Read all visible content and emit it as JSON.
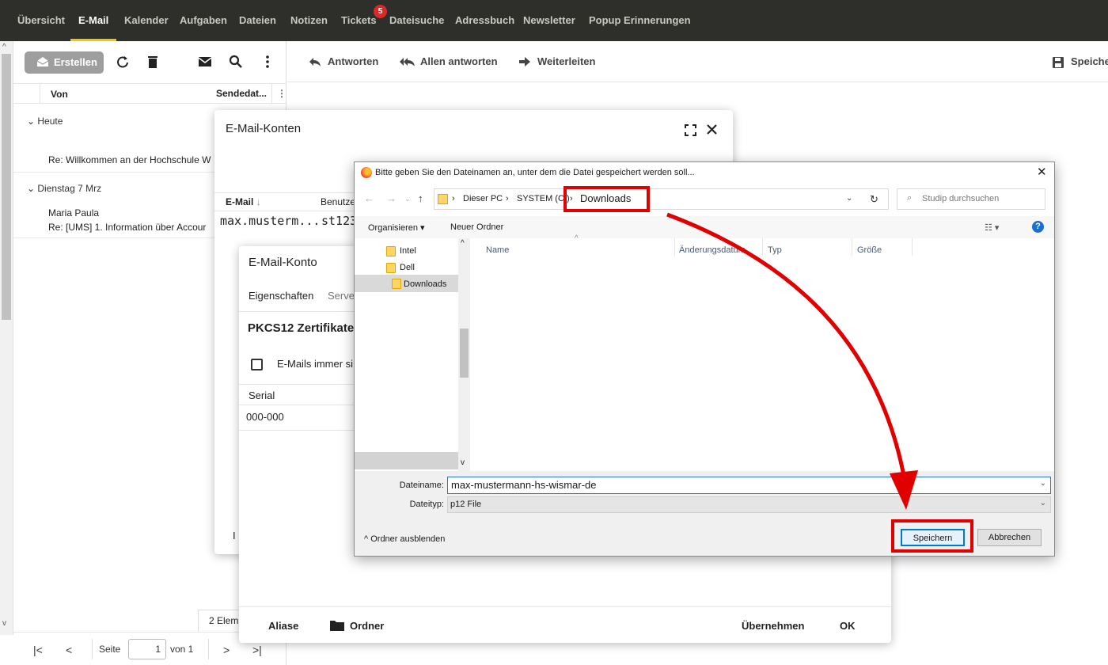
{
  "topnav": {
    "items": [
      "Übersicht",
      "E-Mail",
      "Kalender",
      "Aufgaben",
      "Dateien",
      "Notizen",
      "Tickets",
      "Dateisuche",
      "Adressbuch",
      "Newsletter",
      "Popup Erinnerungen"
    ],
    "active": "E-Mail",
    "tickets_badge": "5"
  },
  "listpanel": {
    "create_label": "Erstellen",
    "col_from": "Von",
    "col_date": "Sendedat...",
    "groups": [
      {
        "label": "Heute",
        "mails": [
          {
            "sender": "",
            "subject": "Re: Willkommen an der Hochschule W"
          }
        ]
      },
      {
        "label": "Dienstag 7 Mrz",
        "mails": [
          {
            "sender": "Maria Paula",
            "subject": "Re: [UMS] 1. Information über Accour"
          }
        ]
      }
    ],
    "count_label": "2 Elem",
    "pager": {
      "page_label": "Seite",
      "page_value": "1",
      "of_label": "von 1"
    }
  },
  "reader_toolbar": {
    "reply": "Antworten",
    "reply_all": "Allen antworten",
    "forward": "Weiterleiten",
    "save": "Speicher"
  },
  "accounts_dialog": {
    "title": "E-Mail-Konten",
    "col_email": "E-Mail",
    "col_user": "Benutze",
    "row_email": "max.musterm...",
    "row_user": "st123",
    "footer_fragment": "I"
  },
  "account_dialog": {
    "title": "E-Mail-Konto",
    "tabs": [
      "Eigenschaften",
      "Serve"
    ],
    "section": "PKCS12 Zertifikate",
    "checkbox_label": "E-Mails immer si",
    "col_serial": "Serial",
    "serial_value": "000-000",
    "footer": {
      "aliases": "Aliase",
      "folder": "Ordner",
      "apply": "Übernehmen",
      "ok": "OK"
    }
  },
  "save_dialog": {
    "title": "Bitte geben Sie den Dateinamen an, unter dem die Datei gespeichert werden soll...",
    "breadcrumb": [
      "Dieser PC",
      "SYSTEM (C:)",
      "Downloads"
    ],
    "search_placeholder": "Studip durchsuchen",
    "organize": "Organisieren",
    "new_folder": "Neuer Ordner",
    "tree": [
      "Intel",
      "Dell",
      "Downloads"
    ],
    "columns": [
      "Name",
      "Änderungsdatum",
      "Typ",
      "Größe"
    ],
    "filename_label": "Dateiname:",
    "filename_value": "max-mustermann-hs-wismar-de",
    "filetype_label": "Dateityp:",
    "filetype_value": "p12 File",
    "hide_folders": "Ordner ausblenden",
    "save_button": "Speichern",
    "cancel_button": "Abbrechen"
  },
  "colors": {
    "nav_bg": "#2e2f2a",
    "accent": "#f0c800",
    "badge": "#d92929",
    "annotation": "#e00000",
    "win_primary": "#0078d7"
  }
}
